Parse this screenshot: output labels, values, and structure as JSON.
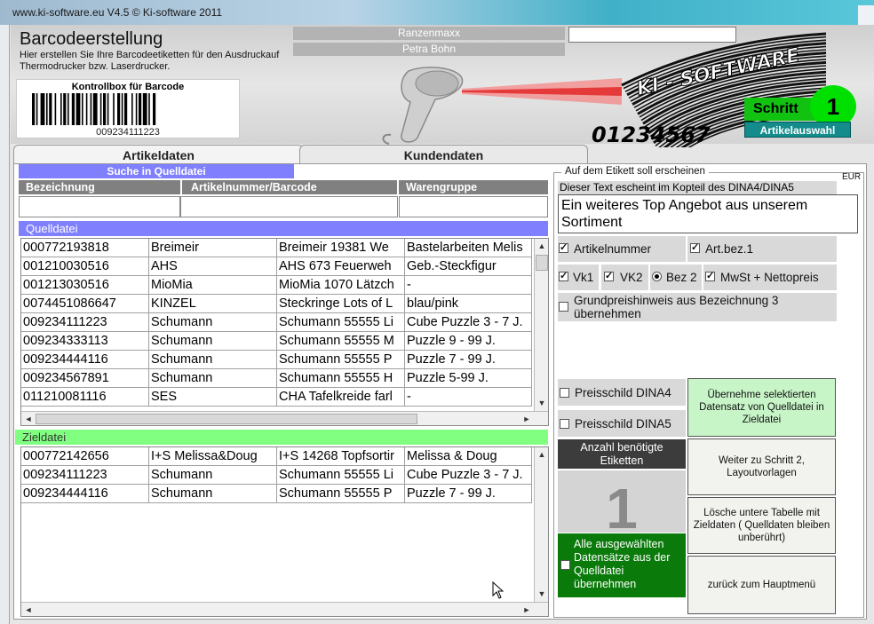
{
  "window": {
    "title": "www.ki-software.eu  V4.5  © Ki-software 2011"
  },
  "header": {
    "title": "Barcodeerstellung",
    "subtitle": "Hier erstellen Sie Ihre Barcodeetiketten für den Ausdruckauf Thermodrucker bzw. Laserdrucker.",
    "control_box_title": "Kontrollbox für Barcode",
    "barcode_number": "009234111223",
    "company": "Ranzenmaxx",
    "user": "Petra Bohn",
    "top_input_value": "",
    "logo_text": "KI - SOFTWARE",
    "logo_digits": "01234567",
    "step_label": "Schritt",
    "step_number": "1",
    "step_name": "Artikelauswahl"
  },
  "tabs": [
    {
      "label": "Artikeldaten"
    },
    {
      "label": "Kundendaten"
    }
  ],
  "search": {
    "title": "Suche in Quelldatei",
    "columns": [
      "Bezeichnung",
      "Artikelnummer/Barcode",
      "Warengruppe"
    ]
  },
  "source": {
    "label": "Quelldatei",
    "rows": [
      [
        "000772193818",
        "Breimeir",
        "Breimeir 19381 We",
        "Bastelarbeiten Melis"
      ],
      [
        "001210030516",
        "AHS",
        "AHS 673 Feuerweh",
        "Geb.-Steckfigur"
      ],
      [
        "001213030516",
        "MioMia",
        "MioMia 1070 Lätzch",
        "-"
      ],
      [
        "0074451086647",
        "KINZEL",
        "Steckringe Lots of L",
        "blau/pink"
      ],
      [
        "009234111223",
        "Schumann",
        "Schumann 55555 Li",
        "Cube Puzzle 3 - 7 J."
      ],
      [
        "009234333113",
        "Schumann",
        "Schumann 55555 M",
        "Puzzle 9 - 99 J."
      ],
      [
        "009234444116",
        "Schumann",
        "Schumann 55555 P",
        "Puzzle 7 - 99 J."
      ],
      [
        "009234567891",
        "Schumann",
        "Schumann 55555 H",
        "Puzzle 5-99 J."
      ],
      [
        "011210081116",
        "SES",
        "CHA Tafelkreide farl",
        "-"
      ]
    ]
  },
  "target": {
    "label": "Zieldatei",
    "rows": [
      [
        "000772142656",
        "I+S Melissa&Doug",
        "I+S 14268 Topfsortir",
        "Melissa & Doug"
      ],
      [
        "009234111223",
        "Schumann",
        "Schumann 55555 Li",
        "Cube Puzzle 3 - 7 J."
      ],
      [
        "009234444116",
        "Schumann",
        "Schumann 55555 P",
        "Puzzle 7 - 99 J."
      ]
    ]
  },
  "label_options": {
    "legend": "Auf dem Etikett soll erscheinen",
    "currency": "EUR",
    "header_hint": "Dieser Text escheint im Kopteil des DINA4/DINA5",
    "header_text": "Ein weiteres Top Angebot aus unserem Sortiment",
    "artikelnummer": "Artikelnummer",
    "artbez": "Art.bez.1",
    "vk1": "Vk1",
    "vk2": "VK2",
    "bez2": "Bez 2",
    "mwst": "MwSt + Nettopreis",
    "grundpreis": "Grundpreishinweis  aus Bezeichnung 3 übernehmen",
    "dina4": "Preisschild DINA4",
    "dina5": "Preisschild DINA5",
    "anzahl_label": "Anzahl benötigte Etiketten",
    "anzahl_value": "1",
    "alle": "Alle ausgewählten Datensätze aus der Quelldatei übernehmen"
  },
  "buttons": {
    "uebernehme": "Übernehme selektierten Datensatz von Quelldatei in  Zieldatei",
    "weiter": "Weiter zu Schritt 2, Layoutvorlagen",
    "loesche": "Lösche untere Tabelle mit Zieldaten ( Quelldaten bleiben unberührt)",
    "zurueck": "zurück zum Hauptmenü"
  }
}
